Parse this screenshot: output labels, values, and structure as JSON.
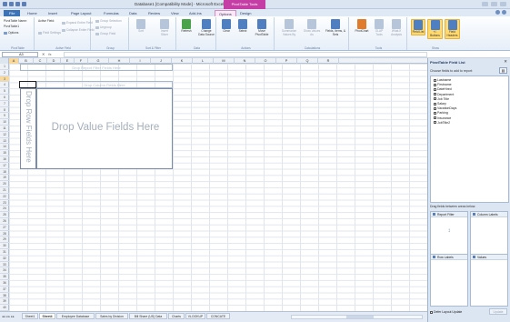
{
  "window": {
    "title": "Database1  [Compatibility Mode]  -  Microsoft Excel",
    "context_tab": "PivotTable Tools"
  },
  "ribbon_tabs": [
    {
      "label": "File"
    },
    {
      "label": "Home"
    },
    {
      "label": "Insert"
    },
    {
      "label": "Page Layout"
    },
    {
      "label": "Formulas"
    },
    {
      "label": "Data"
    },
    {
      "label": "Review"
    },
    {
      "label": "View"
    },
    {
      "label": "Add-Ins"
    },
    {
      "label": "Options"
    },
    {
      "label": "Design"
    }
  ],
  "ribbon": {
    "pivottable_group": {
      "name_label": "PivotTable Name:",
      "name_value": "PivotTable1",
      "options_label": "Options",
      "label": "PivotTable"
    },
    "active_field_group": {
      "field_label": "Active Field:",
      "settings_label": "Field Settings",
      "expand_label": "Expand Entire Field",
      "collapse_label": "Collapse Entire Field",
      "label": "Active Field"
    },
    "group_group": {
      "sel_label": "Group Selection",
      "ungroup_label": "Ungroup",
      "field_label": "Group Field",
      "label": "Group"
    },
    "sort_group": {
      "sort_label": "Sort",
      "insert_slicer_label": "Insert Slicer",
      "label": "Sort & Filter"
    },
    "data_group": {
      "refresh_label": "Refresh",
      "change_source_label": "Change Data Source",
      "label": "Data"
    },
    "actions_group": {
      "clear_label": "Clear",
      "select_label": "Select",
      "move_label": "Move PivotTable",
      "label": "Actions"
    },
    "calc_group": {
      "summarize_label": "Summarize Values By",
      "show_label": "Show Values As",
      "fields_label": "Fields, Items, & Sets",
      "label": "Calculations"
    },
    "tools_group": {
      "chart_label": "PivotChart",
      "olap_label": "OLAP Tools",
      "whatif_label": "What-If Analysis",
      "label": "Tools"
    },
    "show_group": {
      "fieldlist_label": "Field List",
      "buttons_label": "+/- Buttons",
      "headers_label": "Field Headers",
      "label": "Show"
    }
  },
  "formula_bar": {
    "name_box": "A3",
    "fx": "fx",
    "value": ""
  },
  "columns": [
    "A",
    "B",
    "C",
    "D",
    "E",
    "F",
    "G",
    "H",
    "I",
    "J",
    "K",
    "L",
    "M",
    "N",
    "O",
    "P",
    "Q",
    "R"
  ],
  "rows": [
    "1",
    "2",
    "3",
    "4",
    "5",
    "6",
    "7",
    "8",
    "9",
    "10",
    "11",
    "12",
    "13",
    "14",
    "15",
    "16",
    "17",
    "18",
    "19",
    "20",
    "21",
    "22",
    "23",
    "24",
    "25",
    "26",
    "27",
    "28",
    "29",
    "30",
    "31",
    "32",
    "33",
    "34",
    "35",
    "36",
    "37",
    "38",
    "39",
    "40"
  ],
  "pivot": {
    "filter_drop": "Drop Report Filter Fields Here",
    "column_drop": "Drop Column Fields Here",
    "row_drop": "Drop Row Fields Here",
    "value_drop": "Drop Value Fields Here"
  },
  "sheet_tabs": [
    {
      "label": "Sheet1"
    },
    {
      "label": "Sheet4"
    },
    {
      "label": "Employee Database"
    },
    {
      "label": "Sales by Division"
    },
    {
      "label": "Bill Share (US) Data"
    },
    {
      "label": "Charts"
    },
    {
      "label": "VLOOKUP"
    },
    {
      "label": "CONCATE"
    }
  ],
  "field_list": {
    "title": "PivotTable Field List",
    "choose_label": "Choose fields to add to report:",
    "fields": [
      "Lastname",
      "Firstname",
      "DateHired",
      "Department",
      "Job Title",
      "Salary",
      "VacationDays",
      "Parking",
      "Insurance",
      "JobTitle2"
    ],
    "drag_label": "Drag fields between areas below:",
    "areas": {
      "report_filter": "Report Filter",
      "column_labels": "Column Labels",
      "row_labels": "Row Labels",
      "values": "Values"
    },
    "defer_label": "Defer Layout Update",
    "update_label": "Update"
  }
}
